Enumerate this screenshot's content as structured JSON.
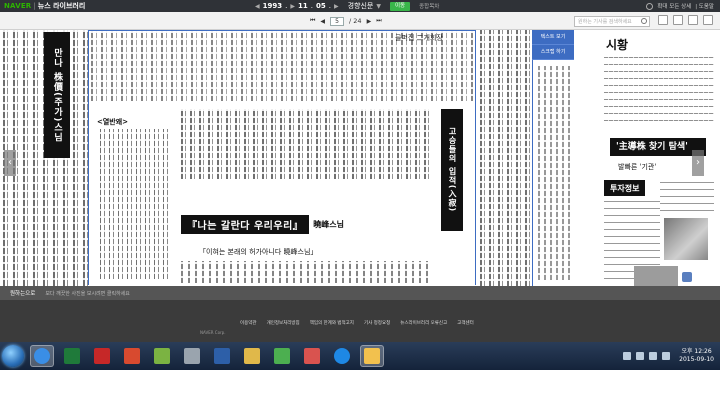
{
  "topbar": {
    "brand": "NAVER",
    "product": "뉴스 라이브러리",
    "date": {
      "year": "1993",
      "month": "11",
      "day": "05"
    },
    "year_suffix": ".",
    "month_suffix": ".",
    "day_suffix": ".",
    "paper": "경향신문",
    "green_button": "이동",
    "extra_text": "종합목차",
    "right_label": "확대 모든 상세",
    "right_text": "| 도움말"
  },
  "subbar": {
    "current_page": "5",
    "total_pages": "/ 24",
    "search_placeholder": "원하는 기사를 검색하세요"
  },
  "viewer": {
    "left_header": "만나 株價(주가)스님",
    "headline_top": "골퍼집 二개회장",
    "bracket_label": "<열반왜>",
    "vertical_title": "고승들의 입적(入寂)",
    "article_headline": "『나는 갈란다 우리우리』",
    "article_headline_tail": "曉峰스님",
    "article_sub": "「이혀는 본래의 허가아니다 曉峰스님」",
    "mode_buttons": [
      "텍스트 보기",
      "스크랩 하기"
    ],
    "right_title": "시황",
    "stock_banner": "'主導株 찾기 탐색'",
    "stock_sub": "발빠른 '기관'",
    "invest": "투자정보"
  },
  "pagestrip": {
    "label": "원하는으로",
    "text": "보다 깨끗한 사진을 보시려면 클릭하세요"
  },
  "footer": {
    "links": [
      "이용약관",
      "개인정보처리방침",
      "책임의 한계와 법적고지",
      "기사 정정요청",
      "뉴스라이브러리 오류신고",
      "고객센터"
    ],
    "copyright": "NAVER Corp."
  },
  "taskbar": {
    "apps": [
      "explorer",
      "internet-explorer",
      "excel",
      "acrobat",
      "pdf-viewer",
      "app-green",
      "recycle",
      "app-blue",
      "paint",
      "notepad",
      "app-red",
      "app-teal",
      "folder"
    ],
    "time": "오후 12:26",
    "date": "2015-09-10"
  }
}
